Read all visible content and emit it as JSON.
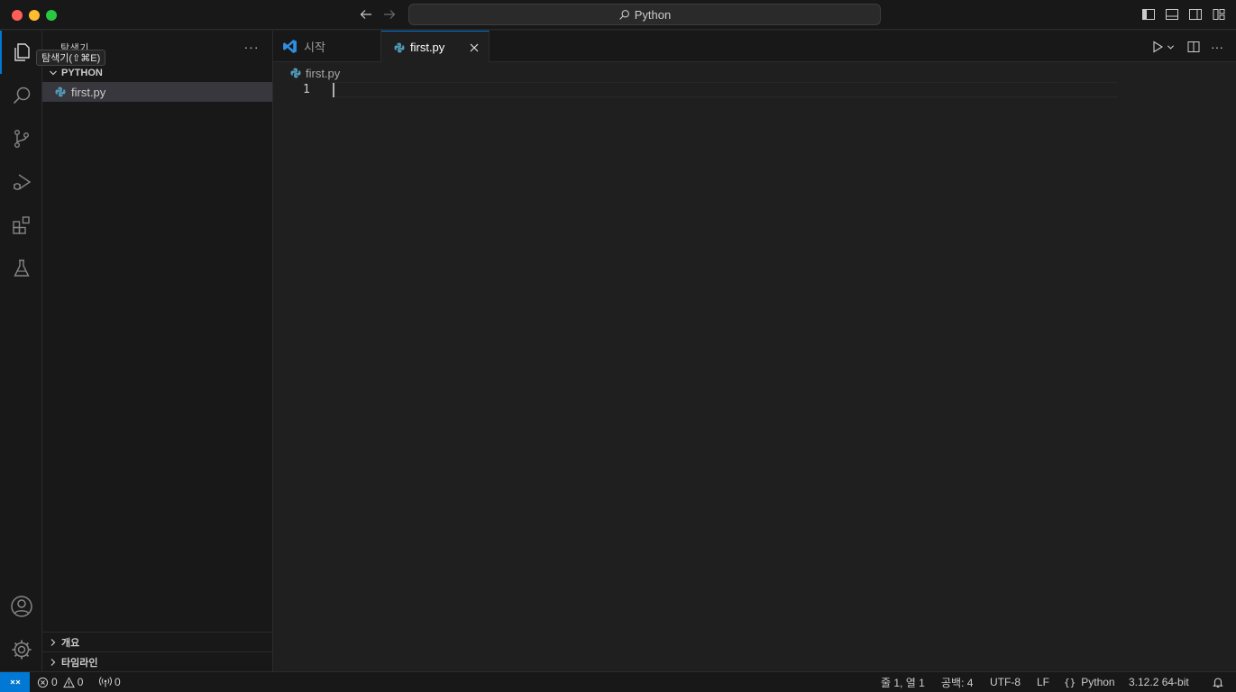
{
  "titlebar": {
    "search_text": "Python"
  },
  "sidebar": {
    "title": "탐색기",
    "tooltip": "탐색기(⇧⌘E)",
    "more": "···",
    "folder": "PYTHON",
    "files": [
      {
        "name": "first.py"
      }
    ],
    "sections": [
      {
        "label": "개요"
      },
      {
        "label": "타임라인"
      }
    ]
  },
  "tabs": [
    {
      "label": "시작",
      "active": false
    },
    {
      "label": "first.py",
      "active": true
    }
  ],
  "editor": {
    "breadcrumb": "first.py",
    "line_numbers": [
      "1"
    ],
    "more": "···"
  },
  "statusbar": {
    "errors": "0",
    "warnings": "0",
    "ports": "0",
    "position": "줄 1, 열 1",
    "spaces": "공백: 4",
    "encoding": "UTF-8",
    "eol": "LF",
    "language": "Python",
    "interpreter": "3.12.2 64-bit"
  },
  "colors": {
    "accent": "#0078d4",
    "python_icon": "#519aba"
  }
}
